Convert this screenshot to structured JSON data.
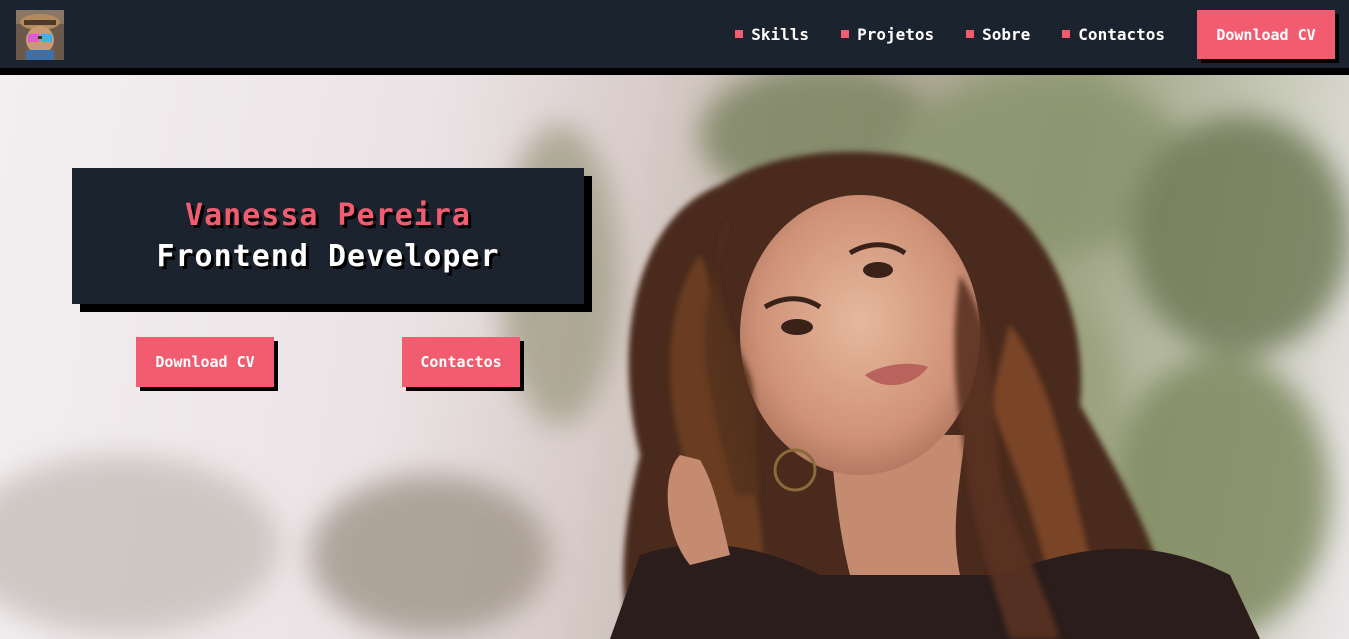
{
  "nav": {
    "logo_alt": "Vanessa Pereira avatar",
    "links": [
      {
        "label": "Skills"
      },
      {
        "label": "Projetos"
      },
      {
        "label": "Sobre"
      },
      {
        "label": "Contactos"
      }
    ],
    "cv_button": "Download CV"
  },
  "hero": {
    "name": "Vanessa Pereira",
    "role": "Frontend Developer",
    "cv_button": "Download CV",
    "contact_button": "Contactos"
  },
  "colors": {
    "accent": "#f25c70",
    "dark": "#1b232e",
    "shadow": "#000000"
  }
}
